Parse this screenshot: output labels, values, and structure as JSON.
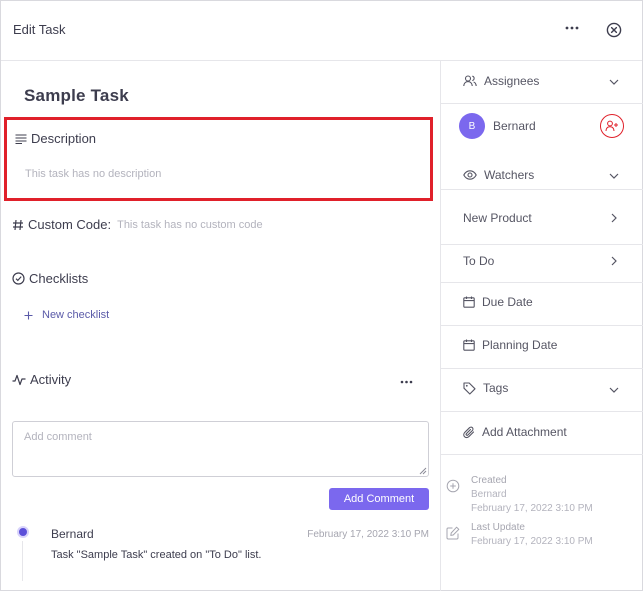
{
  "header": {
    "title": "Edit Task"
  },
  "task": {
    "title": "Sample Task"
  },
  "description": {
    "label": "Description",
    "empty_text": "This task has no description"
  },
  "custom_code": {
    "label": "Custom Code:",
    "empty_text": "This task has no custom code"
  },
  "checklists": {
    "label": "Checklists",
    "new_label": "New checklist"
  },
  "activity": {
    "label": "Activity",
    "comment_placeholder": "Add comment",
    "add_comment_label": "Add Comment",
    "entries": [
      {
        "author": "Bernard",
        "time": "February 17, 2022 3:10 PM",
        "text": "Task \"Sample Task\" created on \"To Do\" list."
      }
    ]
  },
  "sidebar": {
    "assignees_label": "Assignees",
    "assignee": {
      "initial": "B",
      "name": "Bernard"
    },
    "watchers_label": "Watchers",
    "project_label": "New Product",
    "status_label": "To Do",
    "due_date_label": "Due Date",
    "planning_date_label": "Planning Date",
    "tags_label": "Tags",
    "attachment_label": "Add Attachment",
    "created": {
      "label": "Created",
      "by": "Bernard",
      "date": "February 17, 2022 3:10 PM"
    },
    "last_update": {
      "label": "Last Update",
      "date": "February 17, 2022 3:10 PM"
    }
  },
  "icons": {
    "more": "more-horizontal-icon",
    "close": "close-circle-icon",
    "description": "text-lines-icon",
    "custom_code": "hash-icon",
    "checklists": "check-circle-icon",
    "activity": "activity-pulse-icon",
    "assignees": "users-icon",
    "watchers": "eye-icon",
    "calendar": "calendar-icon",
    "tags": "tag-icon",
    "attachment": "paperclip-icon",
    "created": "plus-circle-icon",
    "updated": "edit-icon"
  },
  "colors": {
    "accent": "#7b68ee",
    "highlight": "#e0202a",
    "link": "#5a5aa8",
    "muted": "#b3b3bd"
  }
}
